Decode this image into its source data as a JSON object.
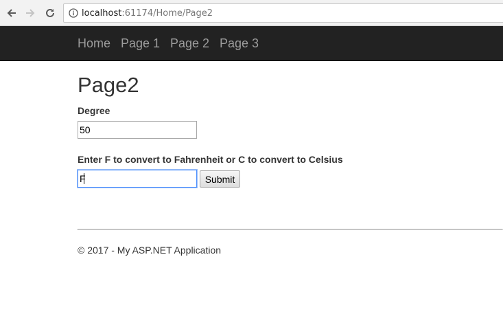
{
  "browser": {
    "url_host": "localhost",
    "url_rest": ":61174/Home/Page2"
  },
  "navbar": {
    "items": [
      {
        "label": "Home"
      },
      {
        "label": "Page 1"
      },
      {
        "label": "Page 2"
      },
      {
        "label": "Page 3"
      }
    ]
  },
  "page": {
    "title": "Page2",
    "degree_label": "Degree",
    "degree_value": "50",
    "unit_label": "Enter F to convert to Fahrenheit or C to convert to Celsius",
    "unit_value": "F",
    "submit_label": "Submit"
  },
  "footer": {
    "text": "© 2017 - My ASP.NET Application"
  },
  "colors": {
    "navbar_bg": "#222222",
    "nav_link": "#9d9d9d",
    "focus_border": "#4d90fe"
  }
}
